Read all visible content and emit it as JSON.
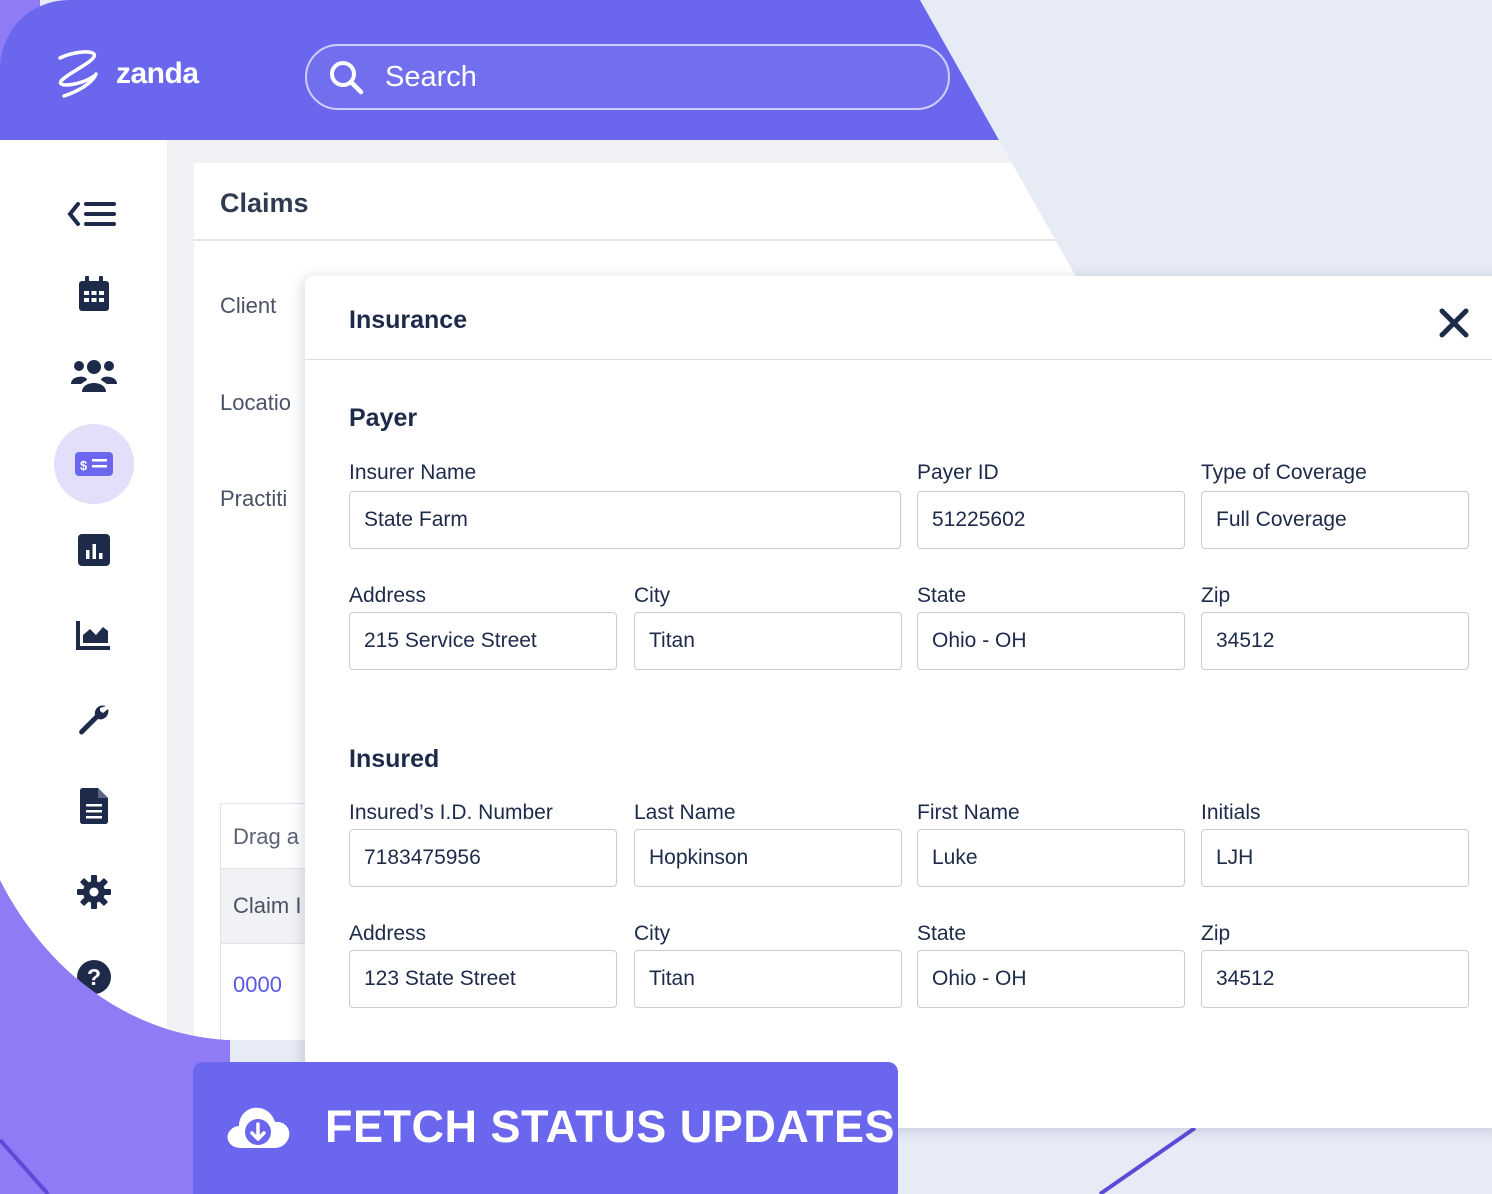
{
  "app": {
    "name": "zanda"
  },
  "search": {
    "placeholder": "Search"
  },
  "sidebar": {
    "items": [
      {
        "icon": "collapse-menu-icon"
      },
      {
        "icon": "calendar-icon"
      },
      {
        "icon": "clients-icon"
      },
      {
        "icon": "billing-icon",
        "active": true
      },
      {
        "icon": "reports-icon"
      },
      {
        "icon": "analytics-icon"
      },
      {
        "icon": "tools-icon"
      },
      {
        "icon": "documents-icon"
      },
      {
        "icon": "settings-icon"
      },
      {
        "icon": "help-icon"
      }
    ]
  },
  "claims": {
    "title": "Claims",
    "labels": {
      "client": "Client",
      "location": "Locatio",
      "practitioner": "Practiti"
    },
    "grid": {
      "drag_text": "Drag a",
      "column_header": "Claim I",
      "first_row": "0000"
    }
  },
  "modal": {
    "title": "Insurance",
    "payer": {
      "section_title": "Payer",
      "insurer_name": {
        "label": "Insurer Name",
        "value": "State Farm"
      },
      "payer_id": {
        "label": "Payer ID",
        "value": "51225602"
      },
      "coverage": {
        "label": "Type of Coverage",
        "value": "Full Coverage"
      },
      "address": {
        "label": "Address",
        "value": "215 Service Street"
      },
      "city": {
        "label": "City",
        "value": "Titan"
      },
      "state": {
        "label": "State",
        "value": "Ohio - OH"
      },
      "zip": {
        "label": "Zip",
        "value": "34512"
      }
    },
    "insured": {
      "section_title": "Insured",
      "id_number": {
        "label": "Insured’s I.D. Number",
        "value": "7183475956"
      },
      "last_name": {
        "label": "Last Name",
        "value": "Hopkinson"
      },
      "first_name": {
        "label": "First Name",
        "value": "Luke"
      },
      "initials": {
        "label": "Initials",
        "value": "LJH"
      },
      "address": {
        "label": "Address",
        "value": "123 State Street"
      },
      "city": {
        "label": "City",
        "value": "Titan"
      },
      "state": {
        "label": "State",
        "value": "Ohio - OH"
      },
      "zip": {
        "label": "Zip",
        "value": "34512"
      }
    }
  },
  "fetch_button": {
    "label": "FETCH STATUS UPDATES",
    "icon": "cloud-download-icon"
  },
  "colors": {
    "brand": "#6a67ee",
    "background": "#e7ebf6",
    "sidebar_active": "#e3def9",
    "text_dark": "#1d2a4a",
    "link": "#5b58e6"
  }
}
